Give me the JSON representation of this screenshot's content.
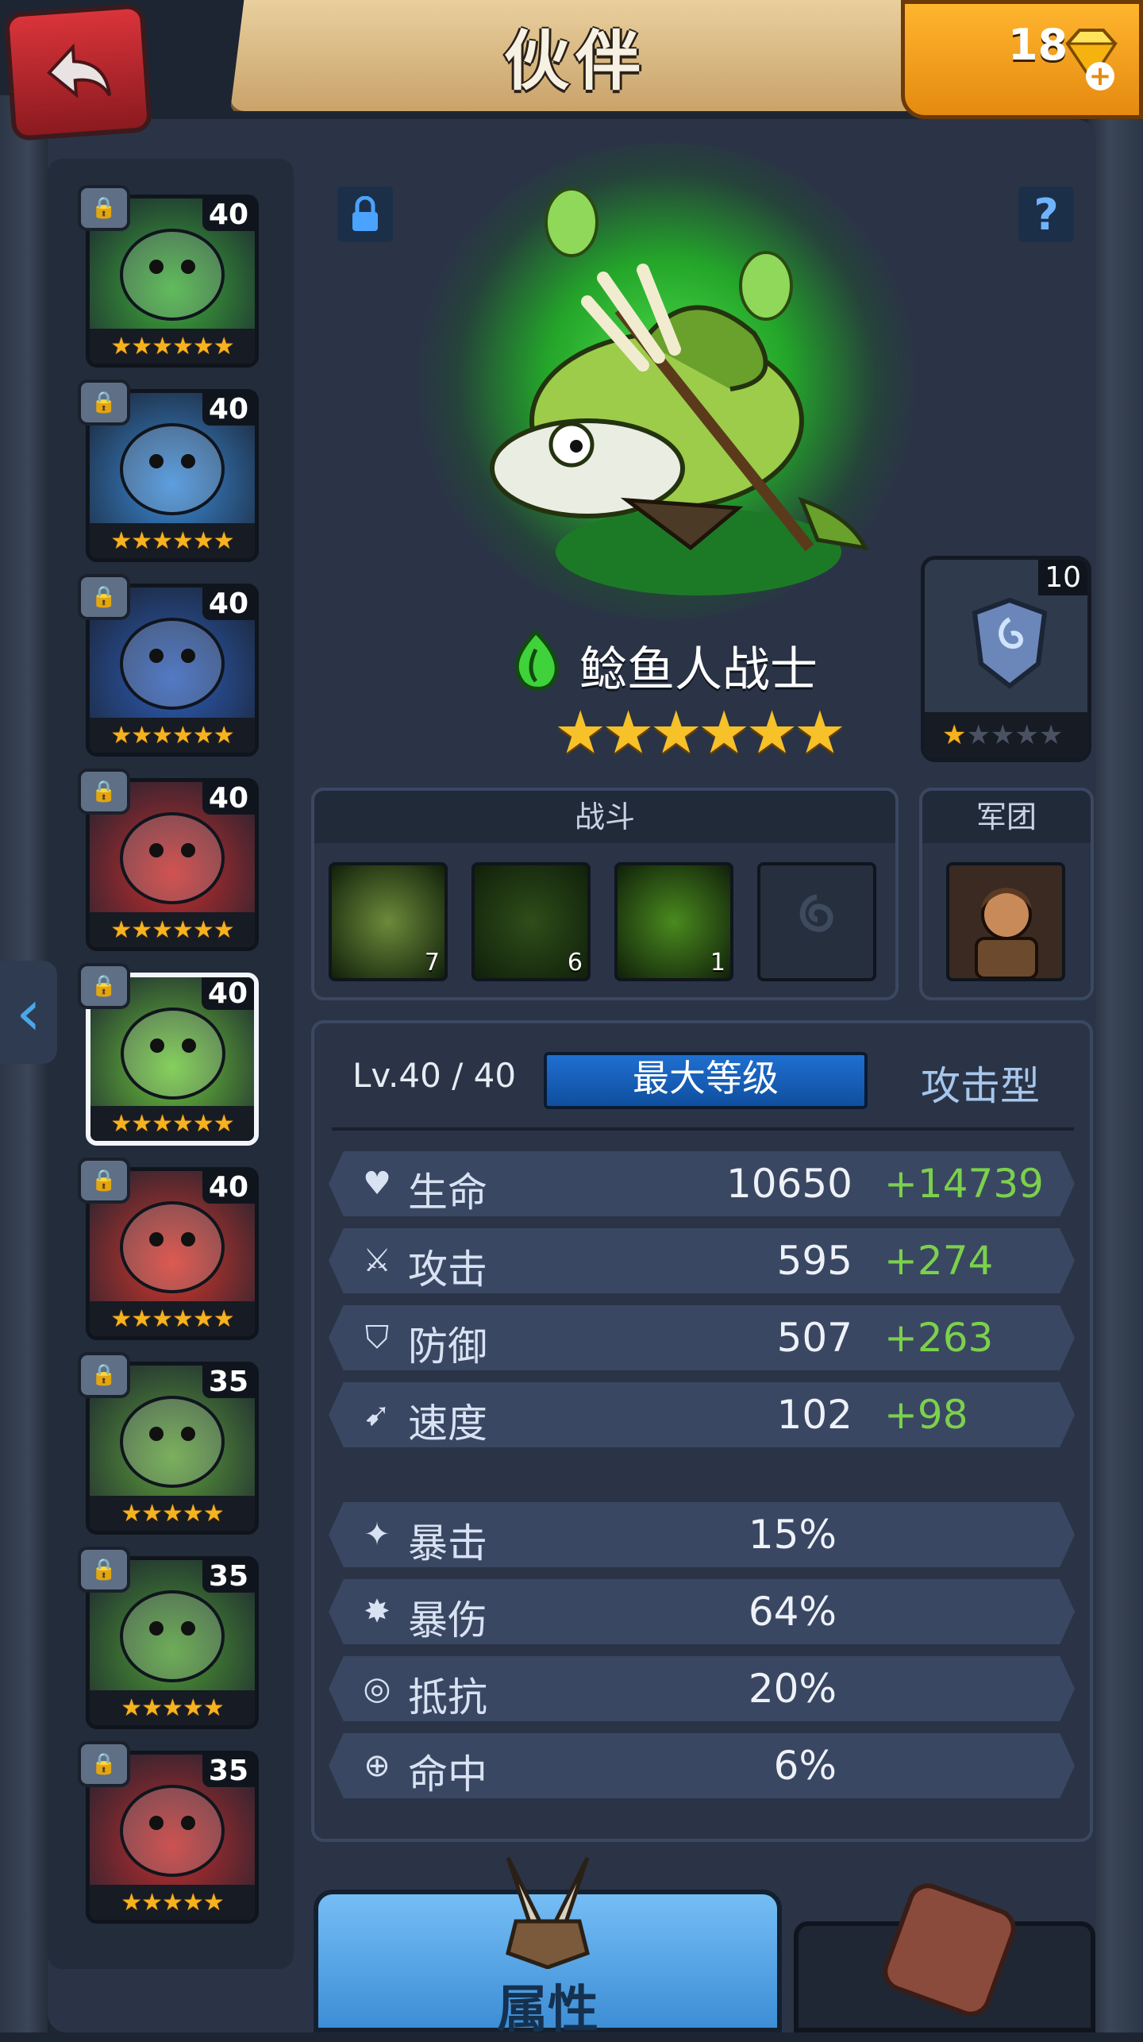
{
  "header": {
    "title": "伙伴",
    "gems": "18"
  },
  "sidebar": {
    "heroes": [
      {
        "level": "40",
        "stars": "★★★★★★",
        "color": "#3fae3a",
        "selected": false
      },
      {
        "level": "40",
        "stars": "★★★★★★",
        "color": "#3a8ad8",
        "selected": false
      },
      {
        "level": "40",
        "stars": "★★★★★★",
        "color": "#2d5db8",
        "selected": false
      },
      {
        "level": "40",
        "stars": "★★★★★★",
        "color": "#c82d2d",
        "selected": false
      },
      {
        "level": "40",
        "stars": "★★★★★★",
        "color": "#6cc63a",
        "selected": true
      },
      {
        "level": "40",
        "stars": "★★★★★★",
        "color": "#d6362b",
        "selected": false
      },
      {
        "level": "35",
        "stars": "★★★★★",
        "color": "#5ea03a",
        "selected": false
      },
      {
        "level": "35",
        "stars": "★★★★★",
        "color": "#4f9b34",
        "selected": false
      },
      {
        "level": "35",
        "stars": "★★★★★",
        "color": "#c22d2d",
        "selected": false
      }
    ]
  },
  "hero": {
    "name": "鲶鱼人战士",
    "stars": "★★★★★★",
    "element": "nature"
  },
  "equipment": {
    "level": "10",
    "stars_filled": "★",
    "stars_empty": "★★★★"
  },
  "skills_panel": {
    "title": "战斗",
    "skills": [
      {
        "level": "7",
        "color": "#6d8a3a"
      },
      {
        "level": "6",
        "color": "#2f4d1a"
      },
      {
        "level": "1",
        "color": "#4a8a1e"
      },
      {
        "level": "",
        "color": "#262f3d"
      }
    ]
  },
  "legion_panel": {
    "title": "军团"
  },
  "stats": {
    "level": "Lv.40 / 40",
    "max_level_label": "最大等级",
    "type": "攻击型",
    "primary": [
      {
        "label": "生命",
        "value": "10650",
        "bonus": "+14739",
        "icon": "heart-icon"
      },
      {
        "label": "攻击",
        "value": "595",
        "bonus": "+274",
        "icon": "sword-icon"
      },
      {
        "label": "防御",
        "value": "507",
        "bonus": "+263",
        "icon": "shield-icon"
      },
      {
        "label": "速度",
        "value": "102",
        "bonus": "+98",
        "icon": "boot-icon"
      }
    ],
    "secondary": [
      {
        "label": "暴击",
        "value": "15%",
        "icon": "crit-icon"
      },
      {
        "label": "暴伤",
        "value": "64%",
        "icon": "crit-damage-icon"
      },
      {
        "label": "抵抗",
        "value": "20%",
        "icon": "resist-icon"
      },
      {
        "label": "命中",
        "value": "6%",
        "icon": "target-icon"
      }
    ]
  },
  "tabs": {
    "attributes": "属性"
  }
}
